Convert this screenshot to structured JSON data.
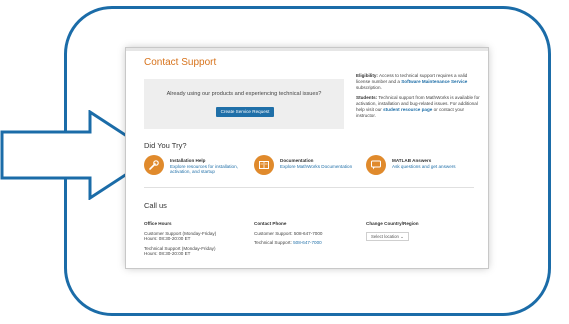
{
  "page": {
    "title": "Contact Support",
    "promo": {
      "text": "Already using our products and experiencing technical issues?",
      "button": "Create Service Request"
    },
    "eligibility": {
      "label": "Eligibility:",
      "text1": "Access to technical support requires a valid license number and a",
      "link": "Software Maintenance Service",
      "text2": "subscription."
    },
    "students": {
      "label": "Students:",
      "text1": "Technical support from MathWorks is available for activation, installation and bug-related issues. For additional help visit our",
      "link": "student resource page",
      "text2": "or contact your instructor."
    },
    "did_you_try": {
      "heading": "Did You Try?",
      "cards": [
        {
          "icon": "wrench-icon",
          "title": "Installation Help",
          "desc": "Explore resources for installation, activation, and startup"
        },
        {
          "icon": "book-icon",
          "title": "Documentation",
          "desc": "Explore MathWorks Documentation"
        },
        {
          "icon": "chat-icon",
          "title": "MATLAB Answers",
          "desc": "Ask questions and get answers"
        }
      ]
    },
    "call_us": {
      "heading": "Call us",
      "office_hours": {
        "heading": "Office Hours",
        "line1": "Customer Support (Monday-Friday)",
        "line2": "Hours: 08:30-20:00 ET",
        "line3": "Technical Support (Monday-Friday)",
        "line4": "Hours: 08:30-20:00 ET"
      },
      "contact_phone": {
        "heading": "Contact Phone",
        "customer_label": "Customer Support:",
        "customer_phone": "508-647-7000",
        "technical_label": "Technical Support:",
        "technical_phone": "508-647-7000"
      },
      "country": {
        "heading": "Change Country/Region",
        "select_value": "Select location"
      }
    }
  },
  "colors": {
    "frame": "#1b6ca8",
    "accent": "#d7731c",
    "link": "#1f6fa8",
    "icon_bg": "#e08a2c"
  }
}
